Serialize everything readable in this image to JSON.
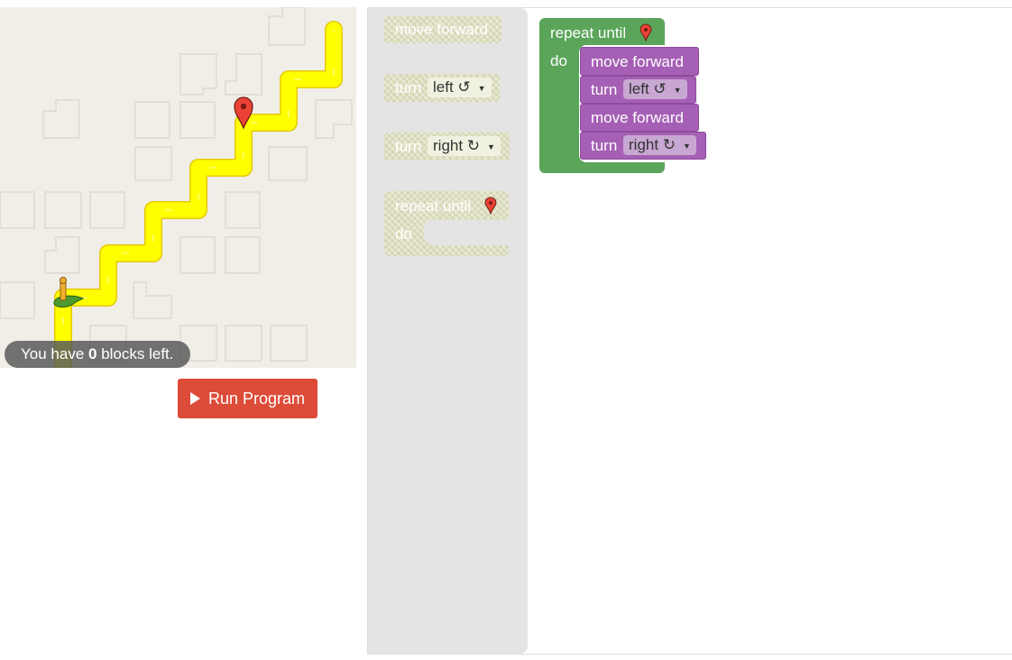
{
  "capacity": {
    "prefix": "You have ",
    "count": "0",
    "suffix": " blocks left."
  },
  "run_button": {
    "label": "Run Program"
  },
  "flyout": {
    "move_forward": "move forward",
    "turn_left": {
      "label": "turn",
      "value": "left ↺"
    },
    "turn_right": {
      "label": "turn",
      "value": "right ↻"
    },
    "repeat": {
      "label": "repeat until",
      "do": "do"
    }
  },
  "program": {
    "repeat_label": "repeat until",
    "do_label": "do",
    "statements": [
      {
        "label": "move forward"
      },
      {
        "label": "turn",
        "value": "left ↺"
      },
      {
        "label": "move forward"
      },
      {
        "label": "turn",
        "value": "right ↻"
      }
    ]
  },
  "colors": {
    "path": "#ffff00",
    "maze_background": "#f1eee7",
    "run_button": "#dd4b39",
    "loop_block": "#5ba55b",
    "movement_block": "#a55fb5",
    "marker": "#ea4335"
  },
  "icons": [
    "goal-marker-icon",
    "pegman-avatar-icon",
    "play-icon",
    "dropdown-arrow-icon"
  ]
}
